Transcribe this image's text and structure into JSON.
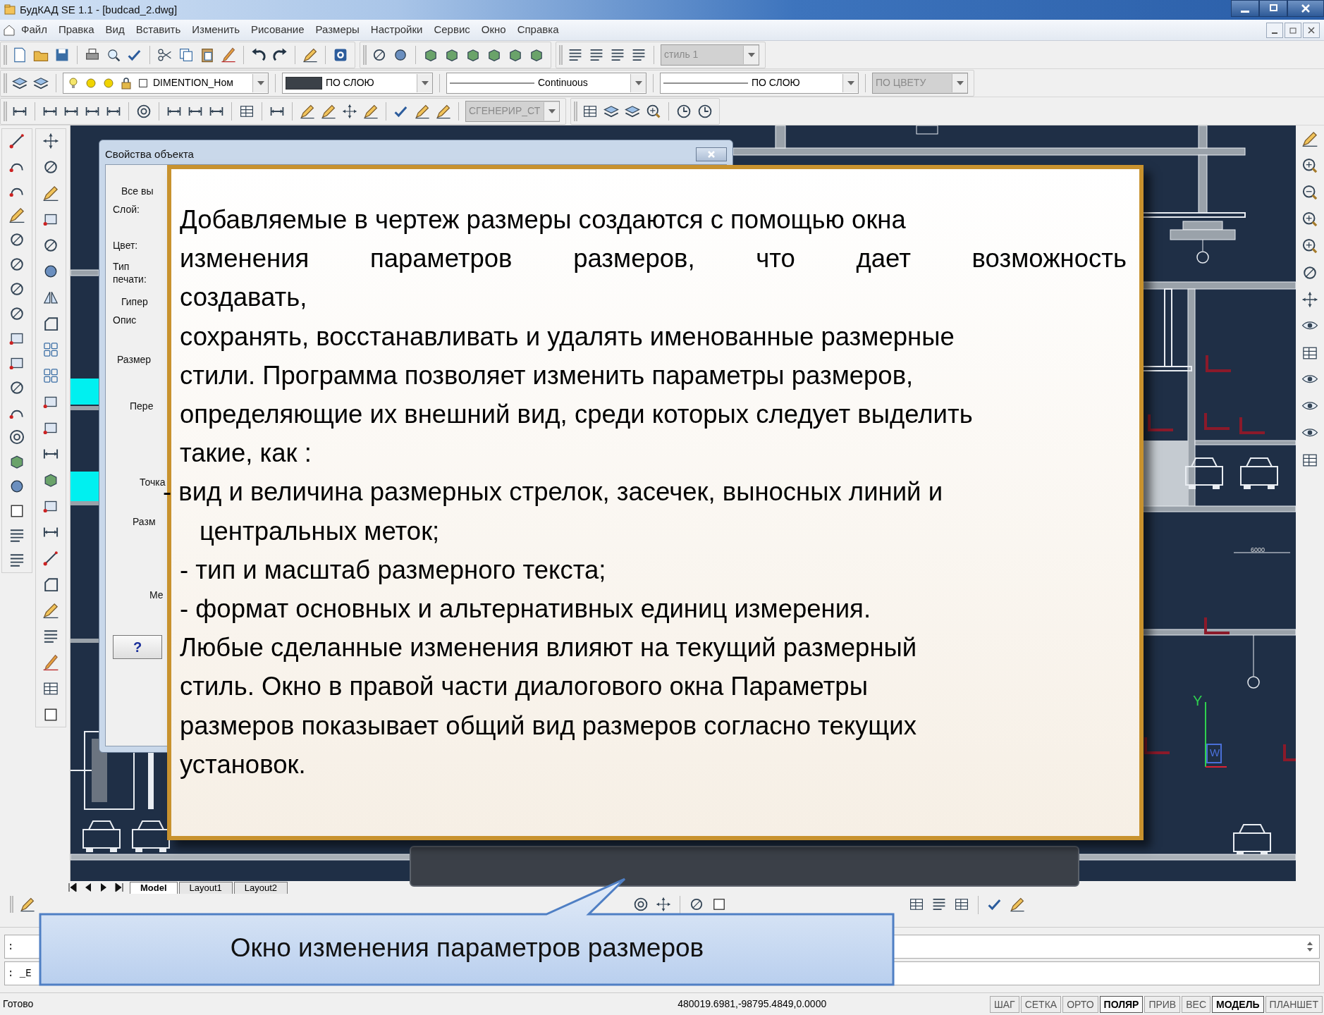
{
  "window": {
    "title": "БудКАД  SE 1.1 - [budcad_2.dwg]"
  },
  "menu": [
    "Файл",
    "Правка",
    "Вид",
    "Вставить",
    "Изменить",
    "Рисование",
    "Размеры",
    "Настройки",
    "Сервис",
    "Окно",
    "Справка"
  ],
  "toolbars": {
    "text_style": {
      "value": "стиль 1",
      "disabled": true
    },
    "layer": {
      "value": "DIMENTION_Ном",
      "disabled": false
    },
    "color": {
      "value": "ПО СЛОЮ",
      "disabled": false
    },
    "linetype": {
      "value": "Continuous",
      "disabled": false
    },
    "lineweight": {
      "value": "ПО СЛОЮ",
      "disabled": false
    },
    "plot_style": {
      "value": "ПО ЦВЕТУ",
      "disabled": true
    },
    "dim_style": {
      "value": "СГЕНЕРИР_СТ",
      "disabled": true
    }
  },
  "dialog": {
    "title": "Свойства объекта",
    "fields": [
      {
        "kind": "legend",
        "text": "Все вы"
      },
      {
        "kind": "label",
        "text": "Слой:"
      },
      {
        "kind": "label",
        "text": "Цвет:"
      },
      {
        "kind": "label",
        "text": "Тип печати:"
      },
      {
        "kind": "legend",
        "text": "Гипер"
      },
      {
        "kind": "label",
        "text": "Опис"
      },
      {
        "kind": "panel",
        "text": "Размер"
      },
      {
        "kind": "label",
        "text": "Пере"
      },
      {
        "kind": "label",
        "text": "Точка"
      },
      {
        "kind": "label",
        "text": "Разм"
      },
      {
        "kind": "label",
        "text": "Ме"
      },
      {
        "kind": "button",
        "text": "?"
      }
    ]
  },
  "drawing": {
    "dimension_text": "6000",
    "axis_labels": [
      "Y",
      "W"
    ]
  },
  "layout_tabs": [
    {
      "label": "Model",
      "selected": true
    },
    {
      "label": "Layout1",
      "selected": false
    },
    {
      "label": "Layout2",
      "selected": false
    }
  ],
  "command_lines": [
    ":",
    ": _E"
  ],
  "status_bar": {
    "message": "Готово",
    "coordinates": "480019.6981,-98795.4849,0.0000",
    "toggles": [
      {
        "label": "ШАГ",
        "on": false
      },
      {
        "label": "СЕТКА",
        "on": false
      },
      {
        "label": "ОРТО",
        "on": false
      },
      {
        "label": "ПОЛЯР",
        "on": true
      },
      {
        "label": "ПРИВ",
        "on": false
      },
      {
        "label": "ВЕС",
        "on": false
      },
      {
        "label": "МОДЕЛЬ",
        "on": true
      },
      {
        "label": "ПЛАНШЕТ",
        "on": false
      }
    ]
  },
  "note_card": {
    "lines": [
      {
        "kind": "plain",
        "text": "Добавляемые в чертеж размеры создаются с помощью окна"
      },
      {
        "kind": "spread",
        "text": "изменения параметров размеров, что дает возможность"
      },
      {
        "kind": "plain",
        "text": "создавать,"
      },
      {
        "kind": "plain",
        "text": "сохранять, восстанавливать и удалять именованные размерные"
      },
      {
        "kind": "plain",
        "text": "стили. Программа позволяет изменить параметры размеров,"
      },
      {
        "kind": "plain",
        "text": "определяющие их внешний вид, среди которых следует выделить"
      },
      {
        "kind": "plain",
        "text": "такие, как :"
      },
      {
        "kind": "outdent",
        "text": "- вид и величина размерных стрелок, засечек, выносных линий и"
      },
      {
        "kind": "indent",
        "text": "центральных меток;"
      },
      {
        "kind": "plain",
        "text": "- тип и масштаб размерного текста;"
      },
      {
        "kind": "plain",
        "text": "- формат основных и альтернативных единиц измерения."
      },
      {
        "kind": "plain",
        "text": "Любые сделанные изменения влияют на текущий размерный"
      },
      {
        "kind": "plain",
        "text": "стиль. Окно в правой части диалогового окна Параметры"
      },
      {
        "kind": "plain",
        "text": "размеров показывает общий вид размеров согласно текущих"
      },
      {
        "kind": "plain",
        "text": "установок."
      }
    ]
  },
  "callout": {
    "text": "Окно изменения параметров размеров"
  }
}
